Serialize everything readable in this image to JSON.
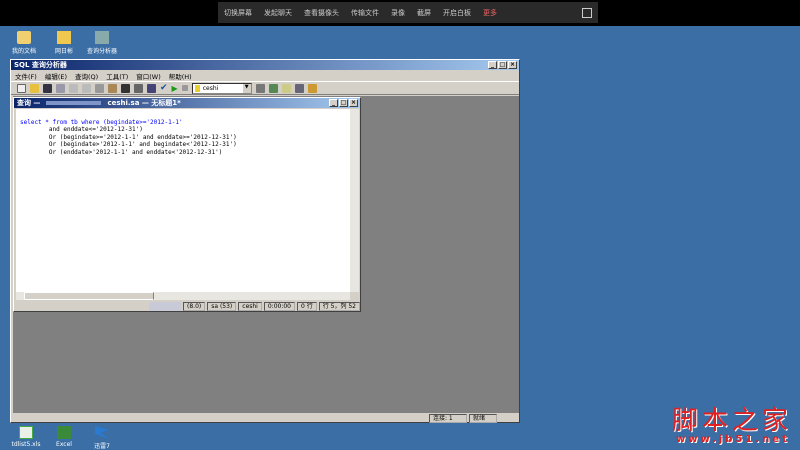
{
  "topbar": {
    "items": [
      "切换屏幕",
      "发起聊天",
      "查看摄像头",
      "传输文件",
      "录像",
      "截屏",
      "开启白板"
    ],
    "more": "更多"
  },
  "desktop": {
    "icons": [
      "我的文档",
      "网日彬",
      "查询分析器"
    ],
    "bottom_icons": [
      "tdlist5.xls",
      "Excel",
      "迅雷7"
    ]
  },
  "app": {
    "title": "SQL 查询分析器",
    "menu": [
      "文件(F)",
      "编辑(E)",
      "查询(Q)",
      "工具(T)",
      "窗口(W)",
      "帮助(H)"
    ],
    "database": "ceshi",
    "status": {
      "connections": "连接: 1",
      "state": "就绪"
    }
  },
  "query_window": {
    "title_prefix": "查询 —",
    "title_server": "ceshi.sa — 无标题1*",
    "sql_lines": [
      "select * from tb where (begindate>='2012-1-1'",
      "        and enddate<='2012-12-31')",
      "        Or (begindate>='2012-1-1' and enddate>='2012-12-31')",
      "        Or (begindate>'2012-1-1' and begindate<'2012-12-31')",
      "        Or (enddate>'2012-1-1' and enddate<'2012-12-31')"
    ],
    "status": {
      "version": "(8.0)",
      "user": "sa (53)",
      "db": "ceshi",
      "time": "0:00:00",
      "rows": "0 行",
      "pos": "行 5，列 52"
    }
  },
  "watermark": {
    "text": "脚本之家",
    "url": "www.jb51.net"
  }
}
